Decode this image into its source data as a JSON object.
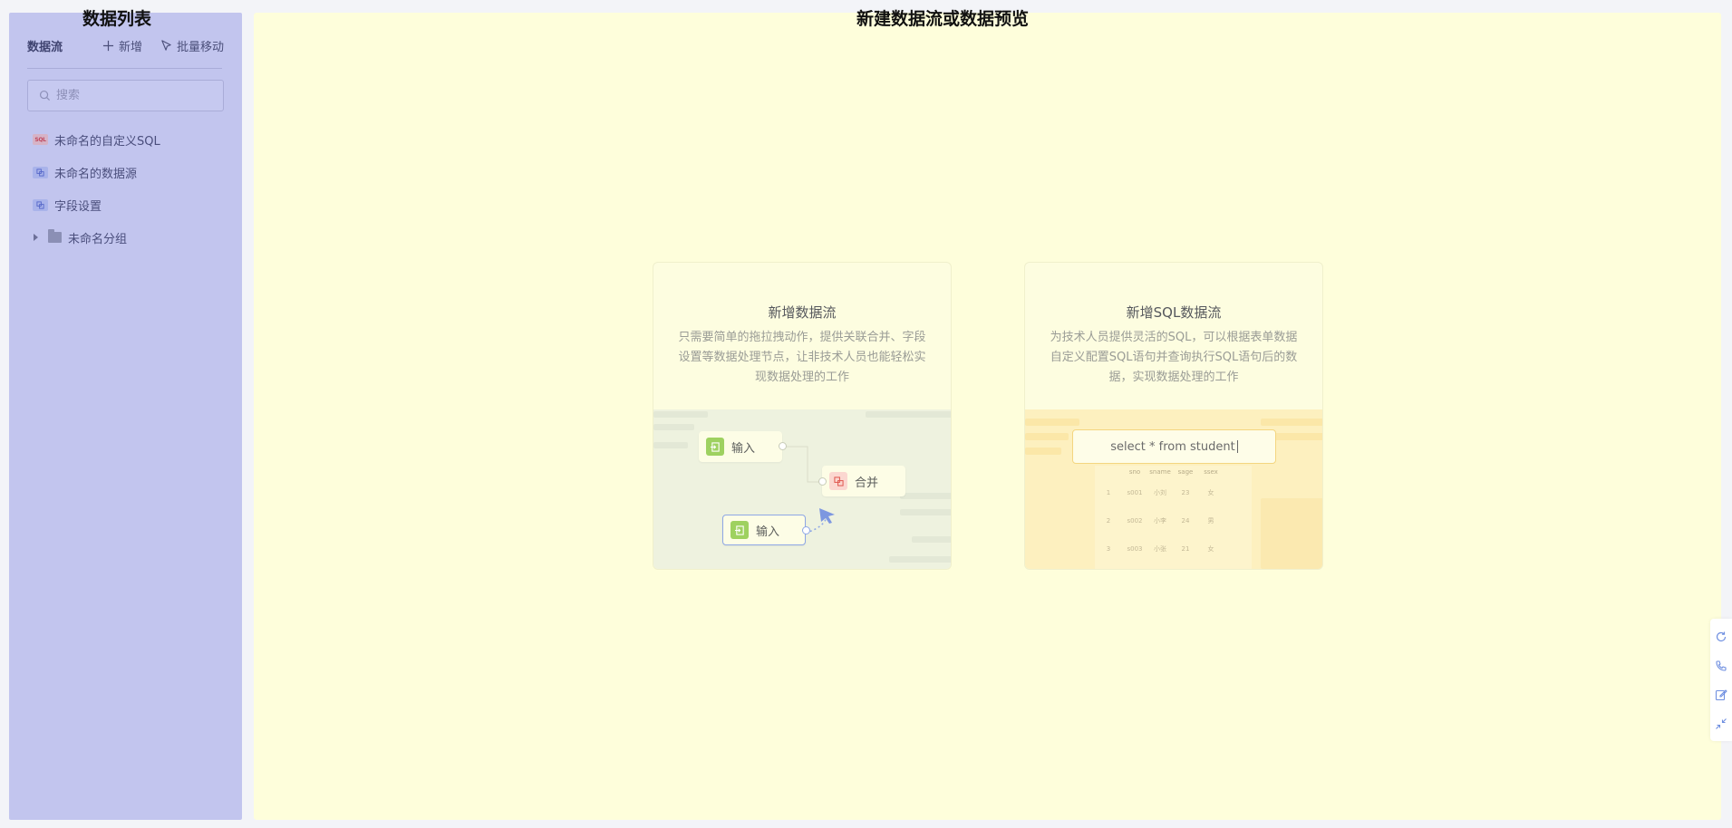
{
  "overlay": {
    "left_title": "数据列表",
    "main_title": "新建数据流或数据预览"
  },
  "sidebar": {
    "header_label": "数据流",
    "add_label": "新增",
    "batch_move_label": "批量移动",
    "search_placeholder": "搜索",
    "items": [
      {
        "label": "未命名的自定义SQL",
        "icon": "sql-icon"
      },
      {
        "label": "未命名的数据源",
        "icon": "datasource-icon"
      },
      {
        "label": "字段设置",
        "icon": "datasource-icon"
      }
    ],
    "group": {
      "label": "未命名分组",
      "icon": "folder-icon",
      "expanded": false
    }
  },
  "cards": {
    "flow": {
      "title": "新增数据流",
      "desc": "只需要简单的拖拉拽动作，提供关联合并、字段设置等数据处理节点，让非技术人员也能轻松实现数据处理的工作",
      "node_input_1": "输入",
      "node_merge": "合并",
      "node_input_2": "输入"
    },
    "sql": {
      "title": "新增SQL数据流",
      "desc": "为技术人员提供灵活的SQL，可以根据表单数据自定义配置SQL语句并查询执行SQL语句后的数据，实现数据处理的工作",
      "sql_text": "select * from student",
      "table": {
        "columns": [
          "",
          "sno",
          "sname",
          "sage",
          "ssex"
        ],
        "rows": [
          [
            "1",
            "s001",
            "小刘",
            "23",
            "女"
          ],
          [
            "2",
            "s002",
            "小李",
            "24",
            "男"
          ],
          [
            "3",
            "s003",
            "小张",
            "21",
            "女"
          ]
        ]
      }
    }
  },
  "colors": {
    "sidebar_bg": "#c2c5ee",
    "main_bg": "#fefedb",
    "input_node": "#9ed160",
    "accent_blue": "#8ea7e6"
  },
  "float_toolbar": [
    "refresh-icon",
    "phone-icon",
    "edit-icon",
    "collapse-icon"
  ]
}
